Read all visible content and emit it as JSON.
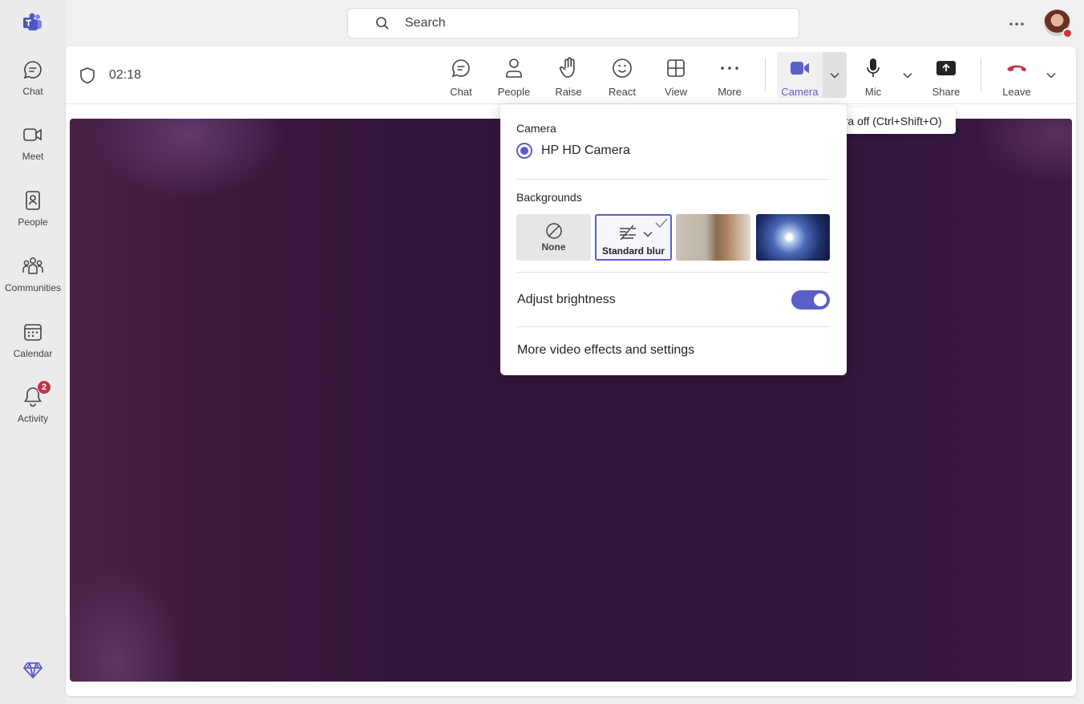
{
  "rail": {
    "items": [
      {
        "label": "Chat",
        "icon": "chat-icon"
      },
      {
        "label": "Meet",
        "icon": "video-camera-icon"
      },
      {
        "label": "People",
        "icon": "contacts-icon"
      },
      {
        "label": "Communities",
        "icon": "communities-icon"
      },
      {
        "label": "Calendar",
        "icon": "calendar-icon"
      },
      {
        "label": "Activity",
        "icon": "bell-icon",
        "badge": "2"
      }
    ]
  },
  "search": {
    "placeholder": "Search"
  },
  "meeting": {
    "timer": "02:18",
    "toolbar": {
      "chat": "Chat",
      "people": "People",
      "raise": "Raise",
      "react": "React",
      "view": "View",
      "more": "More",
      "camera": "Camera",
      "mic": "Mic",
      "share": "Share",
      "leave": "Leave"
    }
  },
  "tooltip": {
    "text": "Turn camera off (Ctrl+Shift+O)"
  },
  "flyout": {
    "camera_heading": "Camera",
    "camera_device": "HP HD Camera",
    "backgrounds_heading": "Backgrounds",
    "bg_none": "None",
    "bg_blur": "Standard blur",
    "adjust_brightness": "Adjust brightness",
    "brightness_enabled": true,
    "more_settings": "More video effects and settings"
  },
  "colors": {
    "accent": "#5b5fc7",
    "leave": "#c4314b",
    "presence_busy": "#d13438"
  }
}
